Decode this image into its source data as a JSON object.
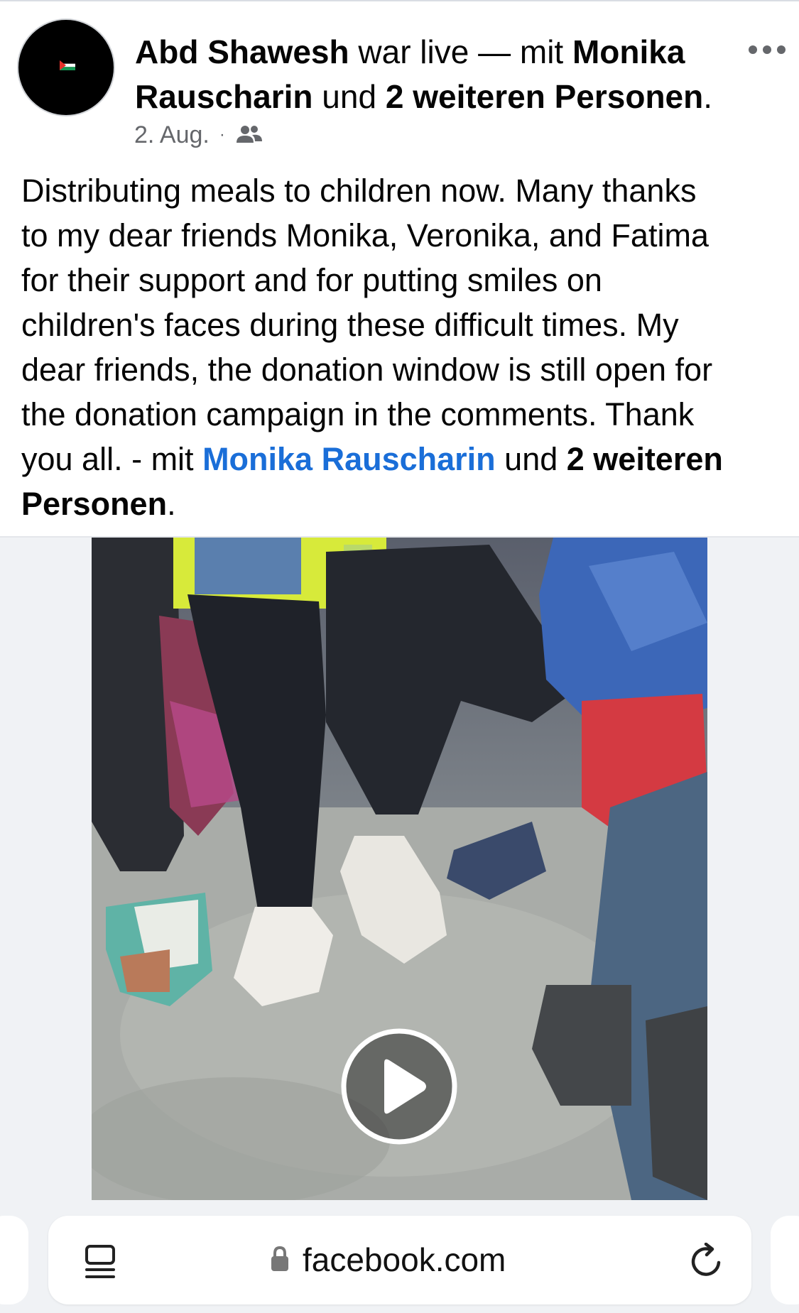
{
  "post": {
    "author": "Abd Shawesh",
    "status_text": " war live — mit ",
    "tagged_name_1": "Monika",
    "tagged_name_2": "Rauscharin",
    "and_text": " und ",
    "others_text": "2 weiteren Personen",
    "header_end": ".",
    "date": "2. Aug.",
    "dot": "·",
    "audience_icon": "friends-icon",
    "more_icon": "more-options-icon"
  },
  "body": {
    "text": "Distributing meals to children now. Many thanks\nto my dear friends Monika, Veronika, and Fatima\nfor their support and for putting smiles on\nchildren's faces during these difficult times. My\ndear friends, the donation window is still open for\nthe donation campaign in the comments. Thank\nyou all. - mit ",
    "tag_link": "Monika Rauscharin",
    "und": " und ",
    "others_line1": "2 weiteren",
    "newline": "\n",
    "others_line2": "Personen",
    "end": "."
  },
  "video": {
    "play_icon": "play-icon"
  },
  "browser": {
    "url": "facebook.com",
    "reader_icon": "reader-mode-icon",
    "lock_icon": "lock-icon",
    "reload_icon": "reload-icon"
  },
  "colors": {
    "link": "#1a6ed8",
    "secondary_text": "#65676b",
    "background": "#ffffff",
    "bar_bg": "#f0f2f5"
  }
}
